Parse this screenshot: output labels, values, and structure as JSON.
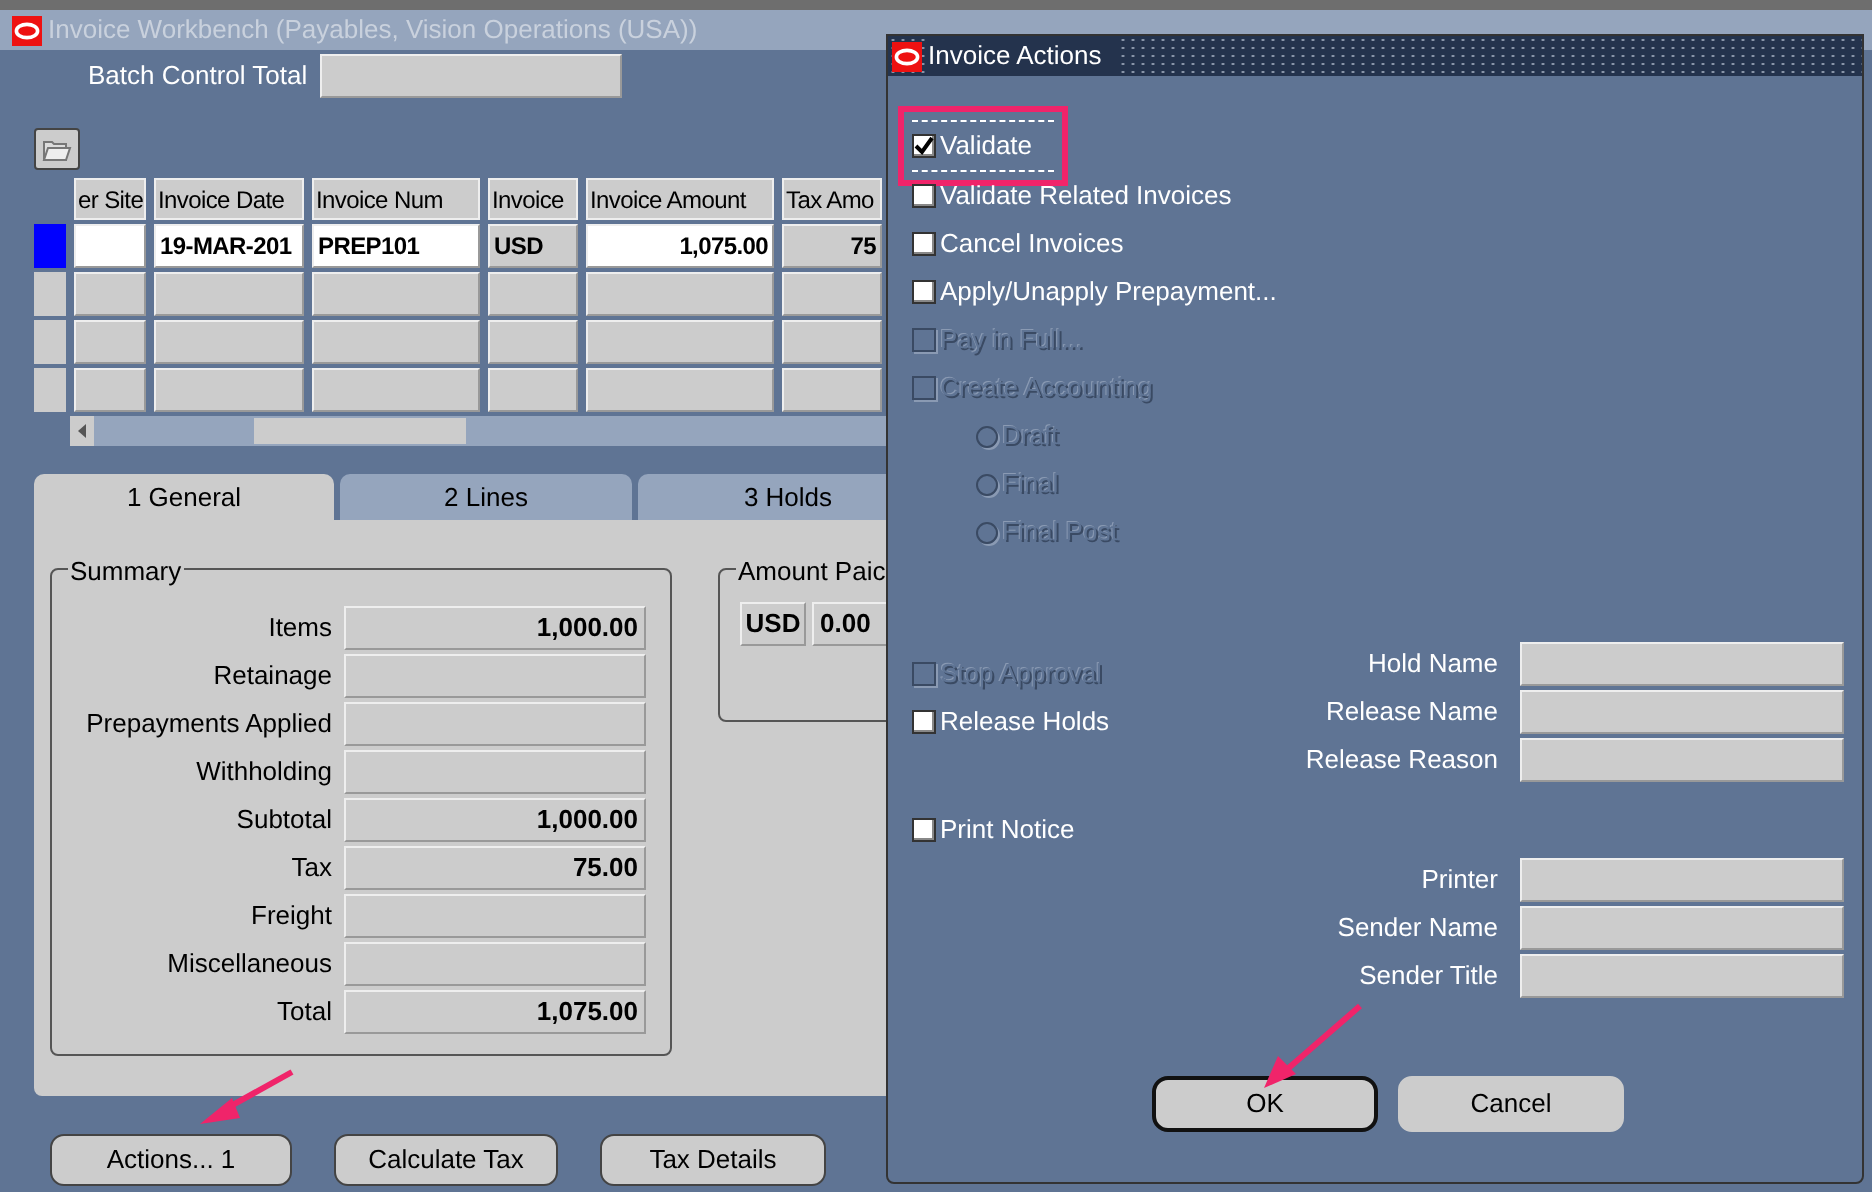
{
  "main_window": {
    "title": "Invoice Workbench (Payables, Vision Operations (USA))",
    "batch_control_total": {
      "label": "Batch Control Total"
    },
    "table": {
      "columns": [
        "er Site",
        "Invoice Date",
        "Invoice Num",
        "Invoice",
        "Invoice Amount",
        "Tax Amo"
      ],
      "rows": [
        {
          "selected": true,
          "cells": [
            "",
            "19-MAR-201",
            "PREP101",
            "USD",
            "1,075.00",
            "75"
          ]
        }
      ]
    },
    "tabs": [
      {
        "label": "1 General",
        "selected": true
      },
      {
        "label": "2 Lines",
        "selected": false
      },
      {
        "label": "3 Holds",
        "selected": false
      }
    ],
    "summary": {
      "title": "Summary",
      "fields": [
        {
          "label": "Items",
          "value": "1,000.00"
        },
        {
          "label": "Retainage"
        },
        {
          "label": "Prepayments Applied"
        },
        {
          "label": "Withholding"
        },
        {
          "label": "Subtotal",
          "value": "1,000.00"
        },
        {
          "label": "Tax",
          "value": "75.00"
        },
        {
          "label": "Freight"
        },
        {
          "label": "Miscellaneous"
        },
        {
          "label": "Total",
          "value": "1,075.00"
        }
      ]
    },
    "amount_paid": {
      "title": "Amount Paic",
      "currency": "USD",
      "value": "0.00"
    },
    "buttons": [
      {
        "label": "Actions... 1",
        "annotated": true
      },
      {
        "label": "Calculate Tax"
      },
      {
        "label": "Tax Details"
      }
    ]
  },
  "dialog": {
    "title": "Invoice Actions",
    "options": [
      {
        "kind": "checkbox",
        "label": "Validate",
        "checked": true,
        "disabled": false,
        "highlighted": true
      },
      {
        "kind": "checkbox",
        "label": "Validate Related Invoices",
        "checked": false,
        "disabled": false,
        "highlighted": false
      },
      {
        "kind": "checkbox",
        "label": "Cancel Invoices",
        "checked": false,
        "disabled": false,
        "highlighted": false
      },
      {
        "kind": "checkbox",
        "label": "Apply/Unapply Prepayment...",
        "checked": false,
        "disabled": false,
        "highlighted": false
      },
      {
        "kind": "checkbox",
        "label": "Pay in Full...",
        "checked": false,
        "disabled": true,
        "highlighted": false
      },
      {
        "kind": "checkbox",
        "label": "Create Accounting",
        "checked": false,
        "disabled": true,
        "highlighted": false
      },
      {
        "kind": "radio",
        "label": "Draft",
        "selected": false,
        "disabled": true
      },
      {
        "kind": "radio",
        "label": "Final",
        "selected": false,
        "disabled": true
      },
      {
        "kind": "radio",
        "label": "Final Post",
        "selected": false,
        "disabled": true
      }
    ],
    "hold_section": {
      "options": [
        {
          "label": "Stop Approval",
          "checked": false,
          "disabled": true
        },
        {
          "label": "Release Holds",
          "checked": false,
          "disabled": false
        }
      ],
      "fields": [
        {
          "label": "Hold Name"
        },
        {
          "label": "Release Name"
        },
        {
          "label": "Release Reason"
        }
      ]
    },
    "print_section": {
      "option": {
        "label": "Print Notice",
        "checked": false,
        "disabled": false
      },
      "fields": [
        {
          "label": "Printer"
        },
        {
          "label": "Sender Name"
        },
        {
          "label": "Sender Title"
        }
      ]
    },
    "buttons": [
      {
        "label": "OK",
        "default": true,
        "annotated": true
      },
      {
        "label": "Cancel",
        "default": false
      }
    ]
  }
}
